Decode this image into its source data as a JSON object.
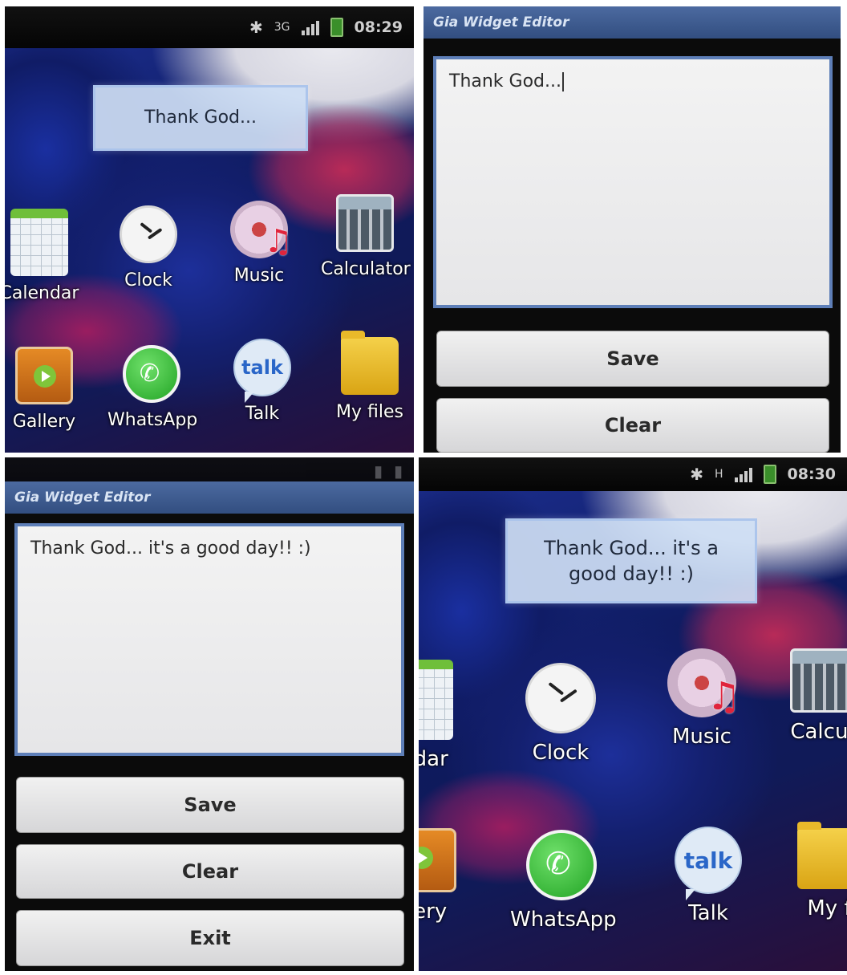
{
  "status_bar_1": {
    "net": "3G",
    "time": "08:29"
  },
  "status_bar_4": {
    "net": "H",
    "time": "08:30"
  },
  "home_1": {
    "widget_text": "Thank God...",
    "apps": [
      {
        "label": "Calendar",
        "icon": "calendar-icon"
      },
      {
        "label": "Clock",
        "icon": "clock-icon"
      },
      {
        "label": "Music",
        "icon": "music-icon"
      },
      {
        "label": "Calculator",
        "icon": "calculator-icon"
      },
      {
        "label": "Gallery",
        "icon": "gallery-icon"
      },
      {
        "label": "WhatsApp",
        "icon": "whatsapp-icon"
      },
      {
        "label": "Talk",
        "icon": "talk-icon"
      },
      {
        "label": "My files",
        "icon": "folder-icon"
      }
    ]
  },
  "editor_1": {
    "title": "Gia Widget Editor",
    "text": "Thank God...",
    "save_label": "Save",
    "clear_label": "Clear"
  },
  "editor_2": {
    "title": "Gia Widget Editor",
    "text": "Thank God... it's a good day!! :)",
    "save_label": "Save",
    "clear_label": "Clear",
    "exit_label": "Exit"
  },
  "home_2": {
    "widget_text": "Thank God... it's a good day!! :)",
    "apps": [
      {
        "label": "endar",
        "icon": "calendar-icon"
      },
      {
        "label": "Clock",
        "icon": "clock-icon"
      },
      {
        "label": "Music",
        "icon": "music-icon"
      },
      {
        "label": "Calcul",
        "icon": "calculator-icon"
      },
      {
        "label": "llery",
        "icon": "gallery-icon"
      },
      {
        "label": "WhatsApp",
        "icon": "whatsapp-icon"
      },
      {
        "label": "Talk",
        "icon": "talk-icon"
      },
      {
        "label": "My f",
        "icon": "folder-icon"
      }
    ]
  },
  "colors": {
    "title_bar": "#3e5c90",
    "widget_bg": "#cedef4",
    "button_bg": "#e4e4e6",
    "wallpaper_blue": "#1d2f9a",
    "wallpaper_magenta": "#b82a58"
  }
}
